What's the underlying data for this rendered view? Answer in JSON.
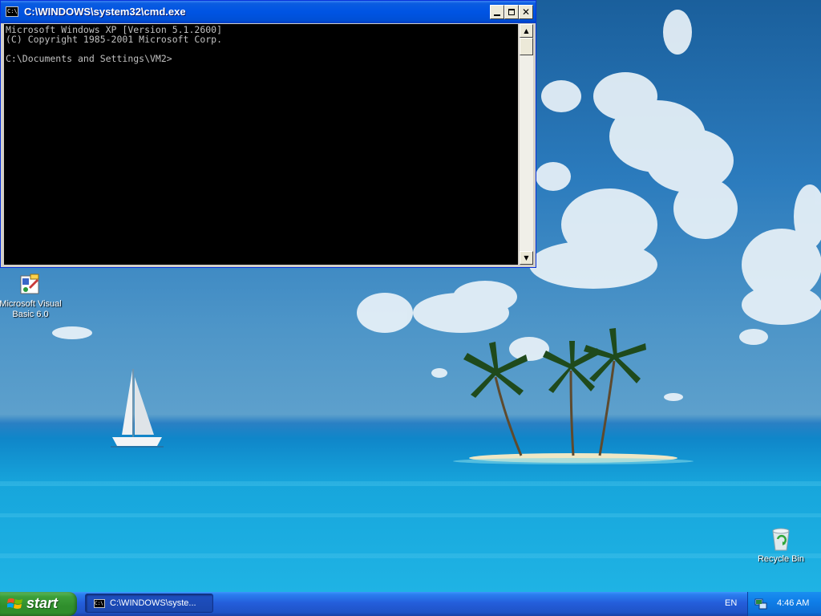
{
  "cmd_window": {
    "title": "C:\\WINDOWS\\system32\\cmd.exe",
    "icon_text": "C:\\",
    "icon": "console-icon",
    "console_text": "Microsoft Windows XP [Version 5.1.2600]\n(C) Copyright 1985-2001 Microsoft Corp.\n\nC:\\Documents and Settings\\VM2>",
    "buttons": {
      "minimize": "minimize-icon",
      "maximize": "maximize-icon",
      "close": "✕"
    },
    "scroll_up": "▲",
    "scroll_down": "▼"
  },
  "desktop_icons": [
    {
      "label": "Microsoft Visual Basic 6.0",
      "icon": "visual-basic-icon"
    },
    {
      "label": "Recycle Bin",
      "icon": "recycle-bin-icon"
    }
  ],
  "taskbar": {
    "start_label": "start",
    "tasks": [
      {
        "label": "C:\\WINDOWS\\syste...",
        "icon_text": "C:\\",
        "icon": "console-icon"
      }
    ],
    "language": "EN",
    "clock": "4:46 AM"
  },
  "colors": {
    "titlebar": "#0054e3",
    "taskbar": "#245edb",
    "start_button": "#3c9f39",
    "console_bg": "#000000",
    "console_text": "#c0c0c0"
  }
}
